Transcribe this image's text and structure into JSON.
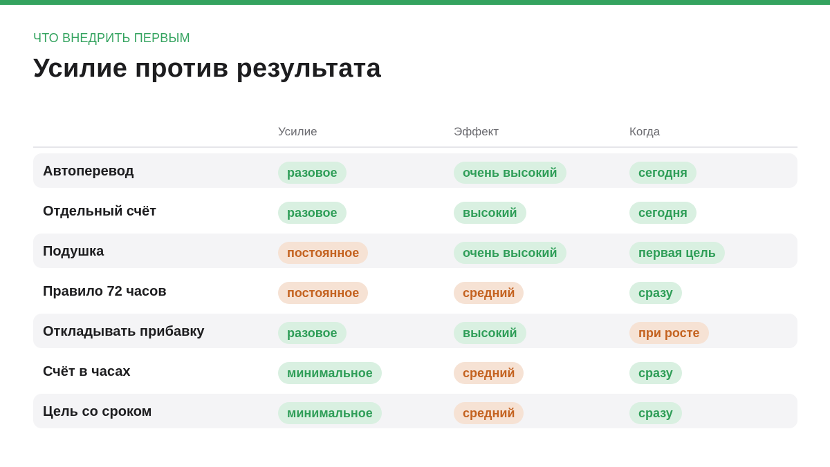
{
  "header": {
    "eyebrow": "ЧТО ВНЕДРИТЬ ПЕРВЫМ",
    "title": "Усилие против результата"
  },
  "colors": {
    "accent": "#34a35f",
    "pill_green_bg": "#d9f0e1",
    "pill_green_text": "#2f9e58",
    "pill_orange_bg": "#f6e2d4",
    "pill_orange_text": "#c4621f"
  },
  "table": {
    "columns": [
      "Усилие",
      "Эффект",
      "Когда"
    ],
    "rows": [
      {
        "label": "Автоперевод",
        "effort": "разовое",
        "effort_tone": "green",
        "effect": "очень высокий",
        "effect_tone": "green",
        "when": "сегодня",
        "when_tone": "green",
        "shaded": true
      },
      {
        "label": "Отдельный счёт",
        "effort": "разовое",
        "effort_tone": "green",
        "effect": "высокий",
        "effect_tone": "green",
        "when": "сегодня",
        "when_tone": "green",
        "shaded": false
      },
      {
        "label": "Подушка",
        "effort": "постоянное",
        "effort_tone": "orange",
        "effect": "очень высокий",
        "effect_tone": "green",
        "when": "первая цель",
        "when_tone": "green",
        "shaded": true
      },
      {
        "label": "Правило 72 часов",
        "effort": "постоянное",
        "effort_tone": "orange",
        "effect": "средний",
        "effect_tone": "orange",
        "when": "сразу",
        "when_tone": "green",
        "shaded": false
      },
      {
        "label": "Откладывать прибавку",
        "effort": "разовое",
        "effort_tone": "green",
        "effect": "высокий",
        "effect_tone": "green",
        "when": "при росте",
        "when_tone": "orange",
        "shaded": true
      },
      {
        "label": "Счёт в часах",
        "effort": "минимальное",
        "effort_tone": "green",
        "effect": "средний",
        "effect_tone": "orange",
        "when": "сразу",
        "when_tone": "green",
        "shaded": false
      },
      {
        "label": "Цель со сроком",
        "effort": "минимальное",
        "effort_tone": "green",
        "effect": "средний",
        "effect_tone": "orange",
        "when": "сразу",
        "when_tone": "green",
        "shaded": true
      }
    ]
  }
}
